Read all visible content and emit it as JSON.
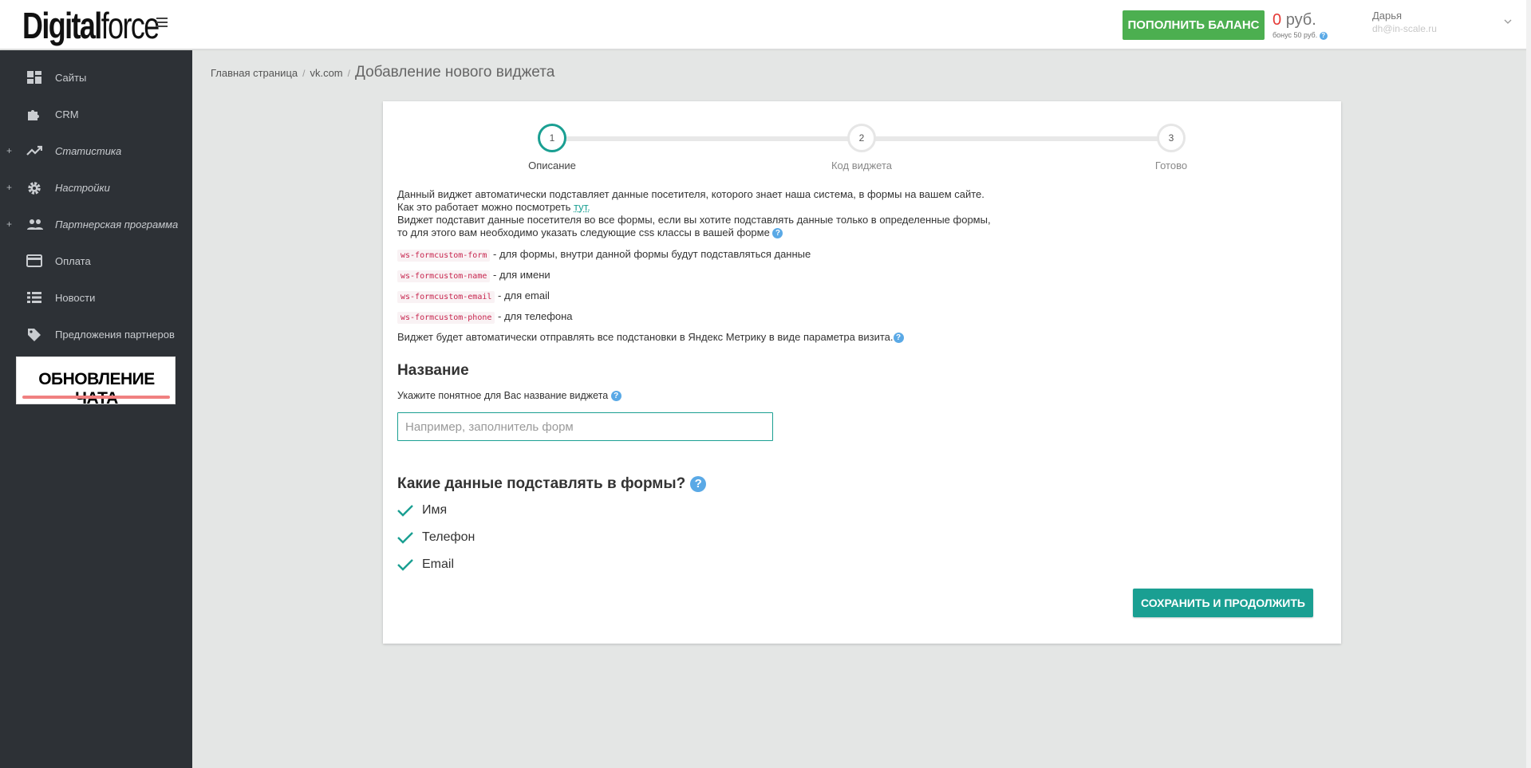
{
  "header": {
    "logo_bold": "Digital",
    "logo_light": "force",
    "topup_label": "ПОПОЛНИТЬ БАЛАНС",
    "balance_amount": "0",
    "balance_currency": "руб.",
    "bonus_text": "бонус 50 руб.",
    "user_name": "Дарья",
    "user_email": "dh@in-scale.ru"
  },
  "sidebar": {
    "items": [
      {
        "label": "Сайты",
        "icon": "dashboard-icon",
        "expandable": false
      },
      {
        "label": "CRM",
        "icon": "puzzle-icon",
        "expandable": false
      },
      {
        "label": "Статистика",
        "icon": "trending-up-icon",
        "expandable": true
      },
      {
        "label": "Настройки",
        "icon": "gear-icon",
        "expandable": true
      },
      {
        "label": "Партнерская программа",
        "icon": "people-icon",
        "expandable": true
      },
      {
        "label": "Оплата",
        "icon": "credit-card-icon",
        "expandable": false
      },
      {
        "label": "Новости",
        "icon": "list-icon",
        "expandable": false
      },
      {
        "label": "Предложения партнеров",
        "icon": "tag-icon",
        "expandable": false
      }
    ],
    "expand_symbol": "+",
    "promo_text": "ОБНОВЛЕНИЕ ЧАТА"
  },
  "breadcrumb": {
    "home": "Главная страница",
    "site": "vk.com",
    "separator": "/",
    "current": "Добавление нового виджета"
  },
  "stepper": {
    "steps": [
      {
        "number": "1",
        "label": "Описание",
        "active": true
      },
      {
        "number": "2",
        "label": "Код виджета",
        "active": false
      },
      {
        "number": "3",
        "label": "Готово",
        "active": false
      }
    ]
  },
  "description": {
    "line1": "Данный виджет автоматически подставляет данные посетителя, которого знает наша система, в формы на вашем сайте.",
    "line2_prefix": "Как это работает можно посмотреть",
    "line2_link": "тут.",
    "line3": "Виджет подставит данные посетителя во все формы, если вы хотите подставлять данные только в определенные формы,",
    "line4": "то для этого вам необходимо указать следующие css классы в вашей форме",
    "css_classes": [
      {
        "code": "ws-formcustom-form",
        "text": "- для формы, внутри данной формы будут подставляться данные"
      },
      {
        "code": "ws-formcustom-name",
        "text": "- для имени"
      },
      {
        "code": "ws-formcustom-email",
        "text": "- для email"
      },
      {
        "code": "ws-formcustom-phone",
        "text": "- для телефона"
      }
    ],
    "metrika": "Виджет будет автоматически отправлять все подстановки в Яндекс Метрику в виде параметра визита."
  },
  "name_section": {
    "title": "Название",
    "hint": "Укажите понятное для Вас название виджета",
    "placeholder": "Например, заполнитель форм",
    "value": ""
  },
  "fields_section": {
    "title": "Какие данные подставлять в формы?",
    "options": [
      {
        "label": "Имя",
        "checked": true
      },
      {
        "label": "Телефон",
        "checked": true
      },
      {
        "label": "Email",
        "checked": true
      }
    ]
  },
  "help_icon_glyph": "?",
  "save_button": "СОХРАНИТЬ И ПРОДОЛЖИТЬ",
  "colors": {
    "sidebar_bg": "#2d3136",
    "accent_teal": "#1a9f92",
    "topup_green": "#4caf50",
    "balance_red": "#e53935",
    "help_blue": "#5aa9e6",
    "code_red": "#c7254e"
  }
}
